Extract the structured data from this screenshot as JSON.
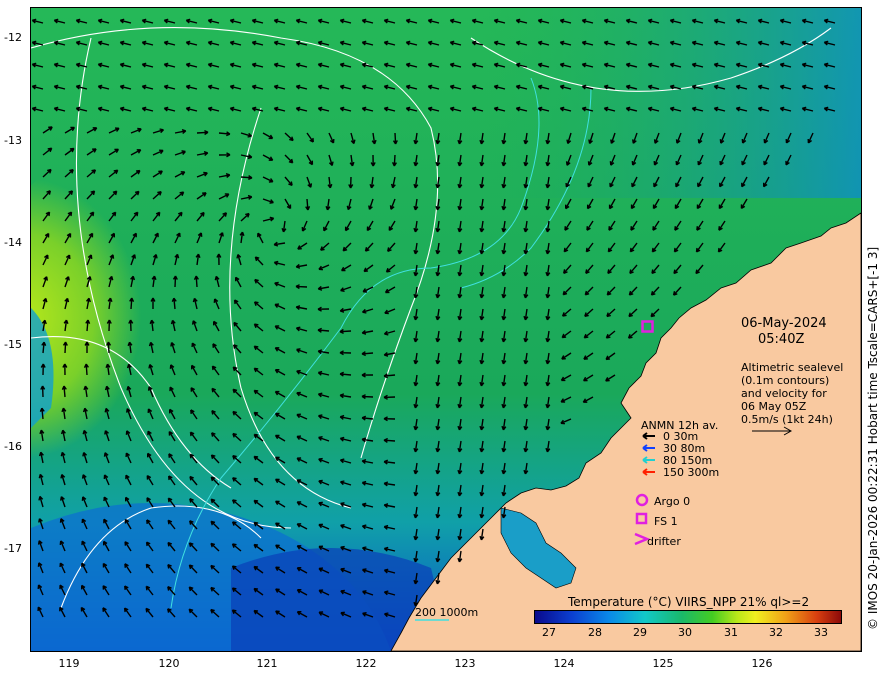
{
  "map": {
    "y_axis_labels": [
      "-12",
      "-13",
      "-14",
      "-15",
      "-16",
      "-17"
    ],
    "x_axis_labels": [
      "119",
      "120",
      "121",
      "122",
      "123",
      "124",
      "125",
      "126"
    ],
    "credit": "© IMOS 20-Jan-2026 00:22:31 Hobart time Tscale=CARS+[-1 3]",
    "date": "06-May-2024",
    "time": "05:40Z",
    "altimetry_text": [
      "Altimetric sealevel",
      "(0.1m contours)",
      "and velocity for",
      "06 May 05Z",
      "0.5m/s (1kt 24h)"
    ],
    "anmn_legend": {
      "title": "ANMN 12h av.",
      "entries": [
        {
          "label": "0 30m",
          "color": "#000000"
        },
        {
          "label": "30 80m",
          "color": "#1040ff"
        },
        {
          "label": "80 150m",
          "color": "#20d0d0"
        },
        {
          "label": "150 300m",
          "color": "#ff2000"
        }
      ]
    },
    "markers": [
      {
        "label": "Argo 0",
        "symbol": "circle-icon",
        "color": "#e020e0"
      },
      {
        "label": "FS 1",
        "symbol": "square-icon",
        "color": "#e020e0"
      },
      {
        "label": "drifter",
        "symbol": "chevron-icon",
        "color": "#e020e0"
      }
    ],
    "bathymetry_label": "200  1000m",
    "colorbar": {
      "title": "Temperature (°C) VIIRS_NPP 21% ql>=2",
      "ticks": [
        "27",
        "28",
        "29",
        "30",
        "31",
        "32",
        "33"
      ]
    },
    "colors": {
      "land": "#f9c9a0",
      "sea_warm": "#1aa85a",
      "sea_cool": "#0a60d8",
      "contour": "#ffffff",
      "isobath": "#40e0e0",
      "marker": "#e020e0"
    }
  }
}
